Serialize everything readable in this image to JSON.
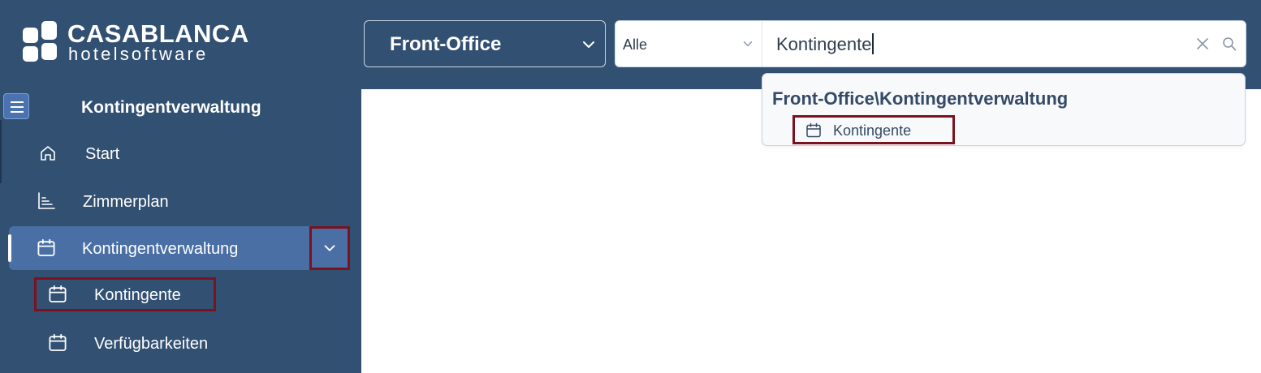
{
  "logo": {
    "name": "CASABLANCA",
    "sub": "hotelsoftware"
  },
  "module_select": {
    "value": "Front-Office"
  },
  "search": {
    "filter_value": "Alle",
    "query": "Kontingente",
    "clear_icon": "close-icon",
    "search_icon": "search-icon"
  },
  "suggestions": {
    "group_label": "Front-Office\\Kontingentverwaltung",
    "items": [
      {
        "label": "Kontingente",
        "icon": "calendar-icon"
      }
    ]
  },
  "sidebar": {
    "title": "Kontingentverwaltung",
    "menu_icon": "hamburger-icon",
    "items": [
      {
        "label": "Start",
        "icon": "home-icon"
      },
      {
        "label": "Zimmerplan",
        "icon": "chart-icon"
      },
      {
        "label": "Kontingentverwaltung",
        "icon": "calendar-icon",
        "active": true,
        "expanded": true
      }
    ],
    "subitems": [
      {
        "label": "Kontingente",
        "icon": "calendar-icon",
        "highlighted": true
      },
      {
        "label": "Verfügbarkeiten",
        "icon": "calendar-icon"
      }
    ]
  },
  "colors": {
    "primary": "#325072",
    "active": "#4a6fa5",
    "highlight_border": "#7b1220",
    "content_bg": "#ffffff"
  }
}
